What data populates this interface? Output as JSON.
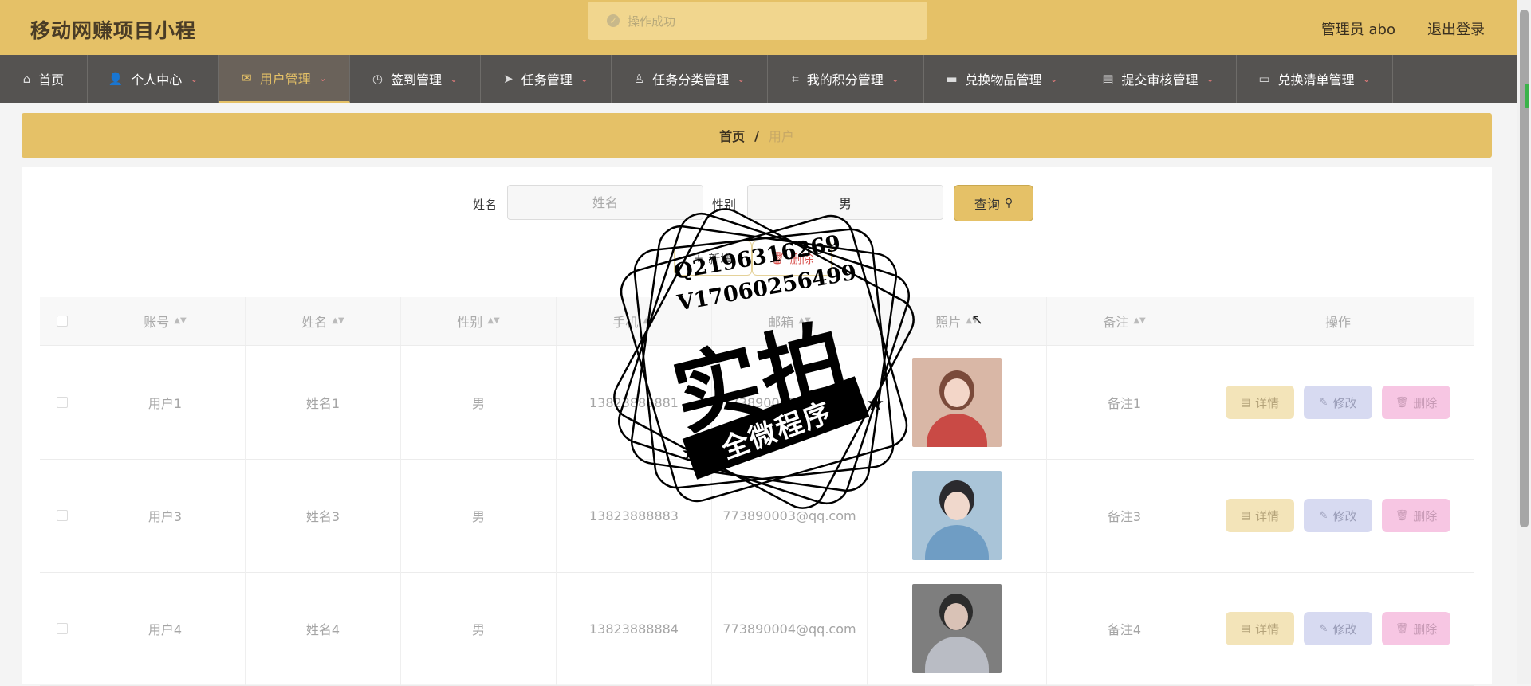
{
  "header": {
    "app_title": "移动网赚项目小程",
    "admin_label": "管理员 abo",
    "logout_label": "退出登录",
    "toast": "操作成功"
  },
  "nav": {
    "items": [
      {
        "label": "首页",
        "icon": "home-icon"
      },
      {
        "label": "个人中心",
        "icon": "user-icon"
      },
      {
        "label": "用户管理",
        "icon": "mail-icon",
        "active": true
      },
      {
        "label": "签到管理",
        "icon": "compass-icon"
      },
      {
        "label": "任务管理",
        "icon": "send-icon"
      },
      {
        "label": "任务分类管理",
        "icon": "person-stamp-icon"
      },
      {
        "label": "我的积分管理",
        "icon": "crop-icon"
      },
      {
        "label": "兑换物品管理",
        "icon": "briefcase-icon"
      },
      {
        "label": "提交审核管理",
        "icon": "clipboard-icon"
      },
      {
        "label": "兑换清单管理",
        "icon": "monitor-icon"
      }
    ]
  },
  "breadcrumb": {
    "home": "首页",
    "sep": "/",
    "current": "用户"
  },
  "search": {
    "name_label": "姓名",
    "name_placeholder": "姓名",
    "name_value": "",
    "gender_label": "性别",
    "gender_value": "男",
    "query_button": "查询"
  },
  "actions": {
    "add": "新增",
    "delete": "删除"
  },
  "table": {
    "columns": [
      "账号",
      "姓名",
      "性别",
      "手机",
      "邮箱",
      "照片",
      "备注",
      "操作"
    ],
    "rows": [
      {
        "account": "用户1",
        "name": "姓名1",
        "gender": "男",
        "phone": "13823888881",
        "email": "773890001@qq.com",
        "note": "备注1"
      },
      {
        "account": "用户3",
        "name": "姓名3",
        "gender": "男",
        "phone": "13823888883",
        "email": "773890003@qq.com",
        "note": "备注3"
      },
      {
        "account": "用户4",
        "name": "姓名4",
        "gender": "男",
        "phone": "13823888884",
        "email": "773890004@qq.com",
        "note": "备注4"
      }
    ],
    "row_buttons": {
      "detail": "详情",
      "edit": "修改",
      "delete": "删除"
    }
  },
  "watermark": {
    "line1": "Q2196316269",
    "line2": "V17060256499",
    "big": "实拍",
    "banner": "全微程序"
  },
  "colors": {
    "primary": "#e5c167",
    "nav_bg": "#555351",
    "detail_btn": "#f3e4b9",
    "edit_btn": "#d7daf1",
    "delete_btn": "#f7c6e3"
  }
}
